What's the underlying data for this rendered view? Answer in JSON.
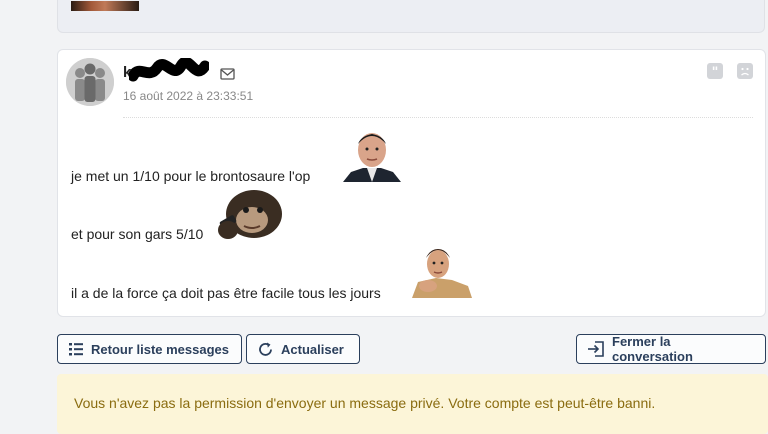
{
  "previous_message": {
    "thumbnail": "sticker-image"
  },
  "message": {
    "author": "k",
    "date": "16 août 2022 à 23:33:51",
    "icons": {
      "mail": "envelope-icon",
      "quote": "quote-icon",
      "report": "sad-face-icon"
    },
    "lines": [
      {
        "text": "je met un 1/10 pour le brontosaure l'op",
        "sticker": "man-in-suit-sticker"
      },
      {
        "text": "et pour son gars 5/10",
        "sticker": "chimp-on-phone-sticker"
      },
      {
        "text": "il a de la force ça doit pas être facile tous les jours",
        "sticker": "man-thinking-sticker"
      }
    ]
  },
  "actions": {
    "back_label": "Retour liste messages",
    "refresh_label": "Actualiser",
    "close_label": "Fermer la conversation"
  },
  "notice": {
    "text": "Vous n'avez pas la permission d'envoyer un message privé. Votre compte est peut-être banni."
  },
  "colors": {
    "button_border": "#2b3f5c",
    "notice_bg": "#fcf5d8",
    "notice_text": "#8a6c10"
  }
}
